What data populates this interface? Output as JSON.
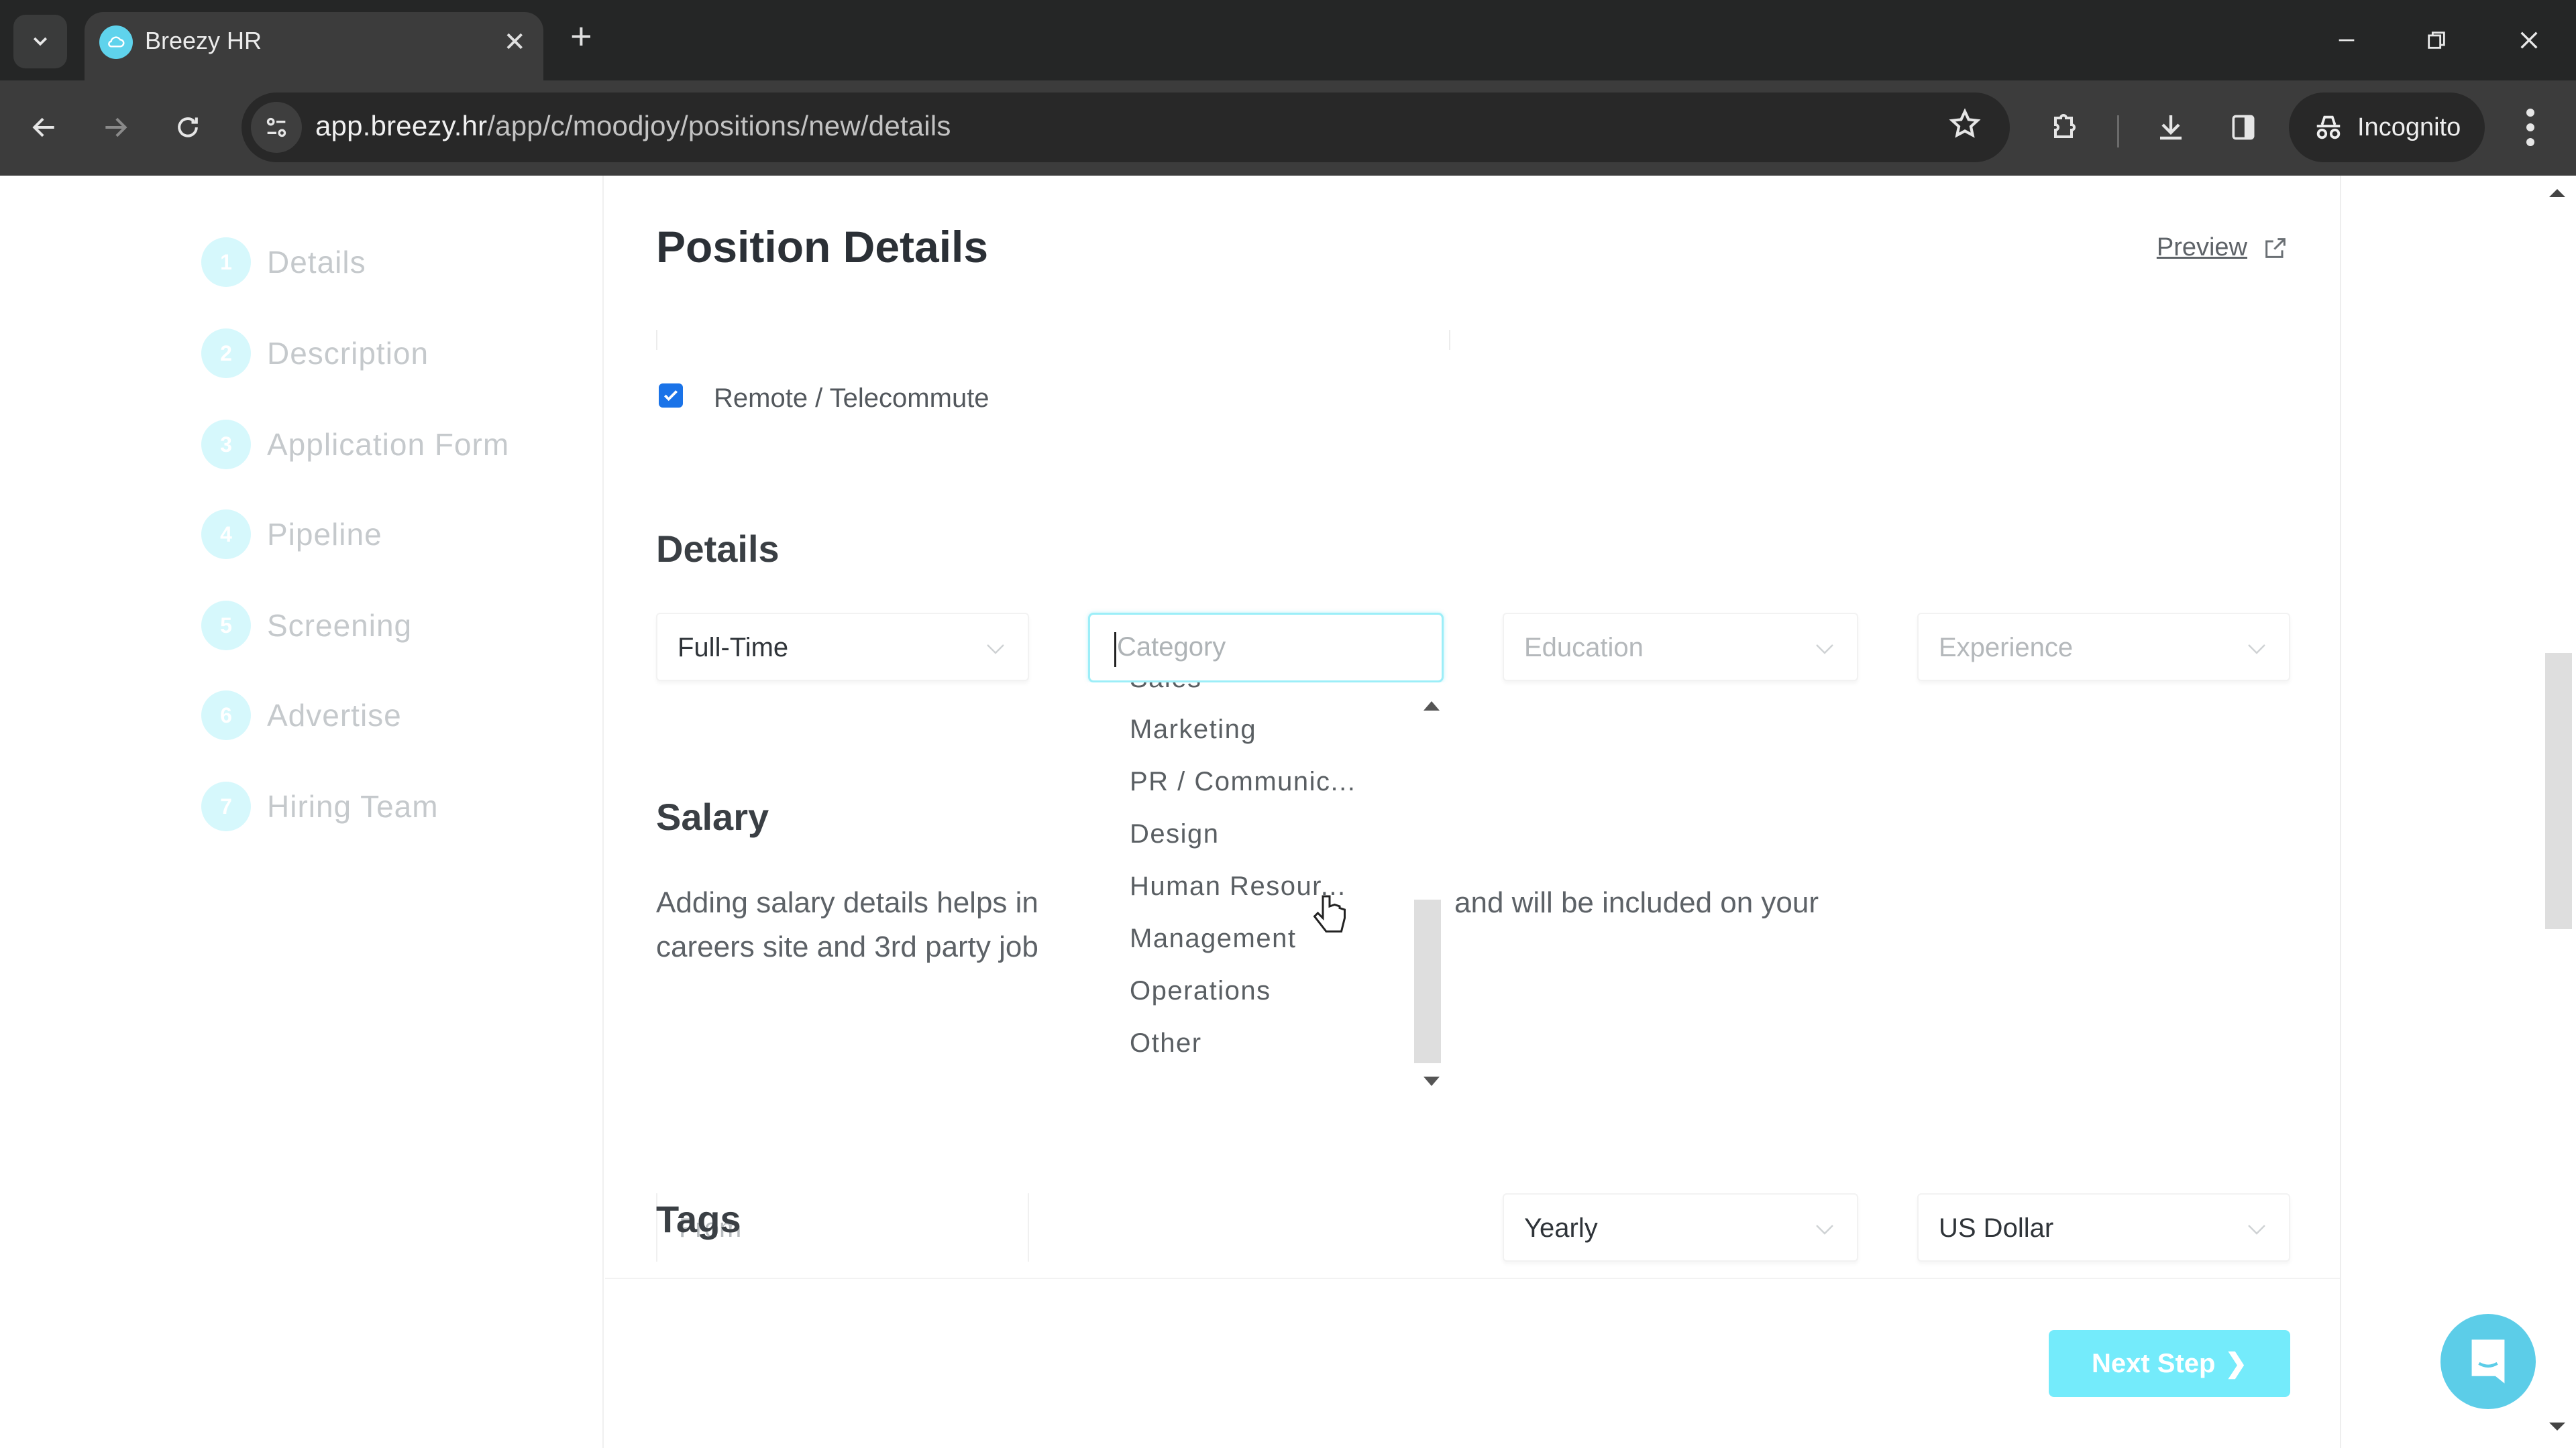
{
  "browser": {
    "tab_title": "Breezy HR",
    "url_host": "app.breezy.hr",
    "url_path": "/app/c/moodjoy/positions/new/details",
    "incognito_label": "Incognito",
    "new_tab_symbol": "+",
    "close_tab_symbol": "✕",
    "icons": {
      "tab_list": "chevron-down-icon",
      "back": "back-arrow-icon",
      "forward": "forward-arrow-icon",
      "reload": "reload-icon",
      "site_info": "tune-icon",
      "bookmark": "star-icon",
      "extensions": "puzzle-icon",
      "downloads": "download-icon",
      "side_panel": "side-panel-icon",
      "menu": "kebab-menu-icon",
      "minimize": "minimize-icon",
      "restore": "restore-icon",
      "close": "close-icon"
    }
  },
  "sidebar": {
    "steps": [
      {
        "num": "1",
        "label": "Details"
      },
      {
        "num": "2",
        "label": "Description"
      },
      {
        "num": "3",
        "label": "Application Form"
      },
      {
        "num": "4",
        "label": "Pipeline"
      },
      {
        "num": "5",
        "label": "Screening"
      },
      {
        "num": "6",
        "label": "Advertise"
      },
      {
        "num": "7",
        "label": "Hiring Team"
      }
    ]
  },
  "main": {
    "title": "Position Details",
    "preview_label": "Preview",
    "remote": {
      "label": "Remote / Telecommute",
      "checked": true
    },
    "details": {
      "heading": "Details",
      "employment_type": "Full-Time",
      "category_placeholder": "Category",
      "education_placeholder": "Education",
      "experience_placeholder": "Experience"
    },
    "category_dropdown": {
      "items": [
        "Sales",
        "Marketing",
        "PR / Communic...",
        "Design",
        "Human Resour...",
        "Management",
        "Operations",
        "Other"
      ],
      "hovered": "Human Resour..."
    },
    "salary": {
      "heading": "Salary",
      "description_line1_left": "Adding salary details helps in",
      "description_line1_right": "and will be included on your",
      "description_line2_left": "careers site and 3rd party job",
      "from_placeholder": "From",
      "period": "Yearly",
      "currency": "US Dollar"
    },
    "tags": {
      "heading": "Tags"
    },
    "next_step_label": "Next Step",
    "next_step_symbol": "❯"
  },
  "colors": {
    "accent": "#74ebfb",
    "step_circle": "#d6f8fc",
    "chat_widget": "#5ccde8",
    "checkbox": "#1a73e8",
    "focus_border": "#9ceef8"
  }
}
